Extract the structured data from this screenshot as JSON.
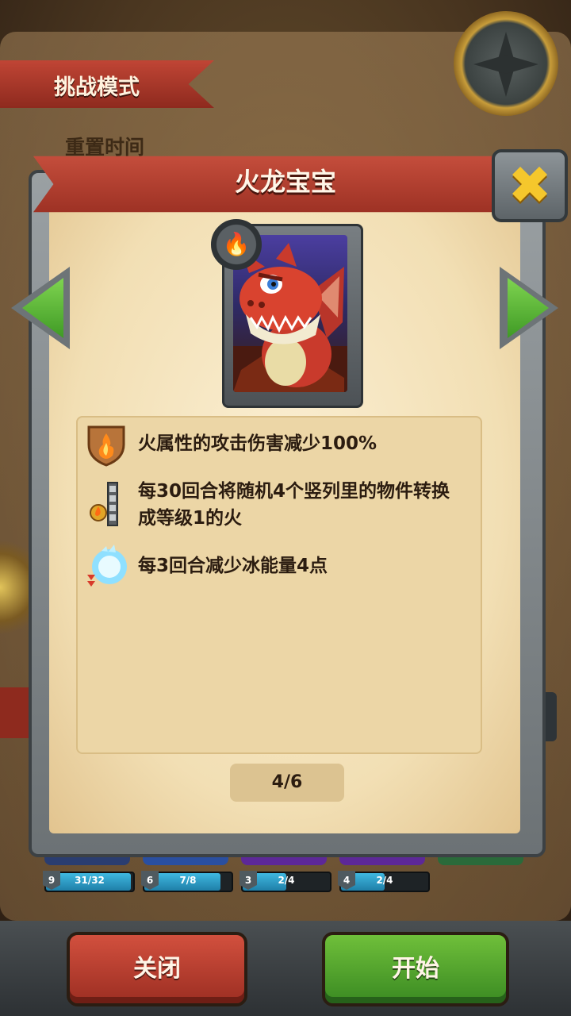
{
  "header": {
    "mode_title": "挑战模式",
    "reset_label": "重置时间"
  },
  "dialog": {
    "title": "火龙宝宝",
    "close_icon": "close-x-icon",
    "prev_icon": "arrow-left-icon",
    "next_icon": "arrow-right-icon",
    "card": {
      "element_icon": "fire-icon",
      "portrait": "red-baby-dragon"
    },
    "effects": [
      {
        "icon": "fire-shield-icon",
        "text": "火属性的攻击伤害减少100%"
      },
      {
        "icon": "column-fire-icon",
        "text": "每30回合将随机4个竖列里的物件转换成等级1的火"
      },
      {
        "icon": "ice-orb-down-icon",
        "text": "每3回合减少冰能量4点"
      }
    ],
    "page_indicator": "4/6"
  },
  "stats": [
    {
      "level": "9",
      "progress": "31/32",
      "fill": 0.97,
      "color": "#2a4a8a"
    },
    {
      "level": "6",
      "progress": "7/8",
      "fill": 0.875,
      "color": "#2a5aa8"
    },
    {
      "level": "3",
      "progress": "2/4",
      "fill": 0.5,
      "color": "#6a2ea8"
    },
    {
      "level": "4",
      "progress": "2/4",
      "fill": 0.5,
      "color": "#6a2ea8"
    }
  ],
  "buttons": {
    "close": "关闭",
    "start": "开始"
  },
  "colors": {
    "ribbon_red": "#b3402f",
    "start_green": "#4fa42c",
    "close_x_gold": "#f5c72c"
  }
}
